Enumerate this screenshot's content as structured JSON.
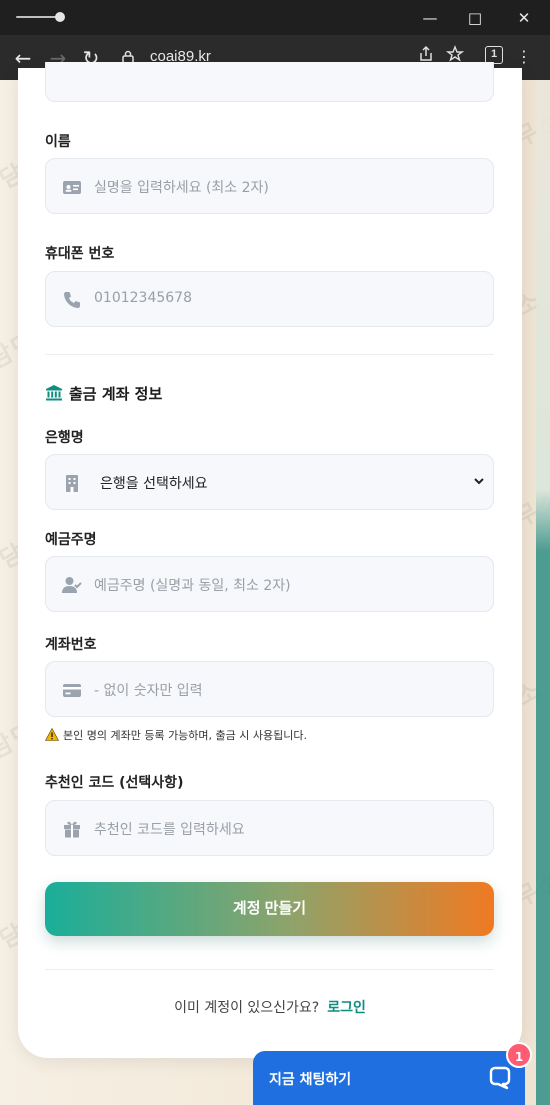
{
  "browser": {
    "url": "coai89.kr",
    "tab_count": "1"
  },
  "form": {
    "name": {
      "label": "이름",
      "placeholder": "실명을 입력하세요 (최소 2자)"
    },
    "phone": {
      "label": "휴대폰 번호",
      "placeholder": "01012345678"
    },
    "bank_section_title": "출금 계좌 정보",
    "bank": {
      "label": "은행명",
      "selected": "은행을 선택하세요"
    },
    "holder": {
      "label": "예금주명",
      "placeholder": "예금주명 (실명과 동일, 최소 2자)"
    },
    "account": {
      "label": "계좌번호",
      "placeholder": "- 없이 숫자만 입력"
    },
    "notice": "본인 명의 계좌만 등록 가능하며, 출금 시 사용됩니다.",
    "referral": {
      "label": "추천인 코드 (선택사항)",
      "placeholder": "추천인 코드를 입력하세요"
    },
    "submit_label": "계정 만들기",
    "login_prompt": "이미 계정이 있으신가요?",
    "login_link": "로그인"
  },
  "chat": {
    "label": "지금 채팅하기",
    "badge": "1"
  },
  "watermark_text": "담덕 법률사무소",
  "colors": {
    "accent": "#0f8d7f",
    "chat_blue": "#1f6fe0",
    "badge": "#ff5b73",
    "gradient_start": "#1aae9a",
    "gradient_end": "#f07a22"
  },
  "icons": [
    "back-icon",
    "forward-icon",
    "reload-icon",
    "lock-icon",
    "share-icon",
    "extension-icon",
    "menu-icon",
    "id-card-icon",
    "phone-icon",
    "bank-icon",
    "building-icon",
    "user-check-icon",
    "credit-card-icon",
    "warning-icon",
    "gift-icon",
    "chat-icon"
  ]
}
